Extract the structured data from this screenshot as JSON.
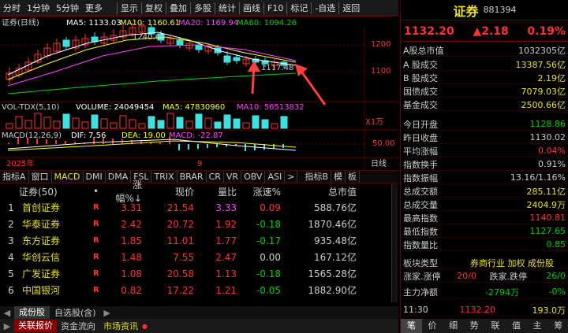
{
  "toolbar": {
    "left_items": [
      "分时",
      "1分钟",
      "5分钟",
      "更多"
    ],
    "right_items": [
      "显示",
      "复权",
      "叠加",
      "多股",
      "统计",
      "画线",
      "F10",
      "标记",
      "-自选",
      "返回"
    ]
  },
  "chart": {
    "title": "证券(日线)",
    "ma": {
      "ma5": "MA5: 1133.03",
      "ma10": "MA10: 1160.61",
      "ma20": "MA20: 1169.94",
      "ma60": "MA60: 1094.26"
    },
    "price_ticks": [
      "1200",
      "1100"
    ],
    "high_label": "1240.65",
    "low_label": "1117.48",
    "vol": {
      "name": "VOL-TDX(5,10)",
      "volume": "VOLUME: 24049454",
      "ma5": "MA5: 47830960",
      "ma10": "MA10: 56513832",
      "unit": "X1万"
    },
    "macd": {
      "name": "MACD(12,26,9)",
      "dif": "DIF: 7.56",
      "dea": "DEA: 19.00",
      "macd": "MACD: -22.87",
      "tick": "50.00"
    },
    "date_left": "2025年",
    "date_mid": "9",
    "date_right": "日线",
    "colors": {
      "up": "#ff3030",
      "down": "#40e0e0",
      "ma5": "#ffffff",
      "ma10": "#ffff00",
      "ma20": "#ff40ff",
      "ma60": "#00d000"
    }
  },
  "indicators": [
    "指标A",
    "窗口",
    "MACD",
    "DMI",
    "DMA",
    "FSL",
    "TRIX",
    "BRAR",
    "CR",
    "VR",
    "OBV",
    "ASI",
    ">",
    "指标B",
    "模",
    "板"
  ],
  "table": {
    "headers": [
      "证券(50)",
      "•",
      "涨幅%↓",
      "现价",
      "量比",
      "涨速%",
      "总市值"
    ],
    "rows": [
      {
        "no": "1",
        "name": "首创证券",
        "flag": "R",
        "chg": "3.31",
        "price": "21.54",
        "vr": "3.33",
        "speed": "0.09",
        "cap": "588.76亿"
      },
      {
        "no": "2",
        "name": "华泰证券",
        "flag": "R",
        "chg": "2.42",
        "price": "20.72",
        "vr": "1.92",
        "speed": "-0.18",
        "cap": "1870.46亿"
      },
      {
        "no": "3",
        "name": "东方证券",
        "flag": "R",
        "chg": "1.85",
        "price": "11.01",
        "vr": "1.77",
        "speed": "-0.17",
        "cap": "935.48亿"
      },
      {
        "no": "4",
        "name": "华创云信",
        "flag": "R",
        "chg": "1.48",
        "price": "7.55",
        "vr": "2.47",
        "speed": "0.00",
        "cap": "167.12亿"
      },
      {
        "no": "5",
        "name": "广发证券",
        "flag": "R",
        "chg": "1.08",
        "price": "20.58",
        "vr": "1.13",
        "speed": "-0.18",
        "cap": "1565.28亿"
      },
      {
        "no": "6",
        "name": "中国银河",
        "flag": "R",
        "chg": "0.82",
        "price": "17.22",
        "vr": "1.21",
        "speed": "-0.05",
        "cap": "1882.90亿"
      }
    ]
  },
  "bottom_tabs": [
    "成份股",
    "自选股(含)"
  ],
  "bottom_bar": [
    "关联报价",
    "资金流向",
    "市场资讯"
  ],
  "right": {
    "name": "证券",
    "code": "881394",
    "price": "1132.20",
    "change": "▲2.18",
    "pct": "0.19%",
    "rows": [
      {
        "k": "A股总市值",
        "v": "1032305亿",
        "c": "#cccccc"
      },
      {
        "k": "A 股成交",
        "v": "13387.56亿",
        "c": "#e8e020"
      },
      {
        "k": "B 股成交",
        "v": "2.19亿",
        "c": "#e8e020"
      },
      {
        "k": "国债成交",
        "v": "7079.03亿",
        "c": "#e8e020"
      },
      {
        "k": "基金成交",
        "v": "2500.66亿",
        "c": "#e8e020"
      },
      {
        "k": "今日开盘",
        "v": "1128.86",
        "c": "#00d000"
      },
      {
        "k": "昨日收盘",
        "v": "1130.02",
        "c": "#cccccc"
      },
      {
        "k": "平均涨幅",
        "v": "0.04%",
        "c": "#ff3030"
      },
      {
        "k": "指数换手",
        "v": "0.91%",
        "c": "#cccccc"
      },
      {
        "k": "指数振幅",
        "v": "13.16/1.16%",
        "c": "#cccccc"
      },
      {
        "k": "总成交额",
        "v": "285.11亿",
        "c": "#e8e020"
      },
      {
        "k": "总成交量",
        "v": "2404.9万",
        "c": "#e8e020"
      },
      {
        "k": "最高指数",
        "v": "1140.81",
        "c": "#ff3030"
      },
      {
        "k": "最低指数",
        "v": "1127.65",
        "c": "#00d000"
      },
      {
        "k": "指数量比",
        "v": "0.85",
        "c": "#00d000"
      }
    ],
    "board_label": "板块类型",
    "board_value": "券商行业 加权 成份股",
    "limit_up_label": "涨家.涨停",
    "limit_up_value": "20/0",
    "limit_down_label": "跌家.跌停",
    "limit_down_value": "26/0",
    "net_label": "主力净额",
    "net_value": "-2794万",
    "net_pct": "-0%",
    "tick_time": "11:30",
    "tick_price": "1132.20",
    "tick_vol": "193.0万",
    "tabs": [
      "笔",
      "价",
      "细",
      "势",
      "联",
      "值",
      "主",
      "筹"
    ]
  }
}
